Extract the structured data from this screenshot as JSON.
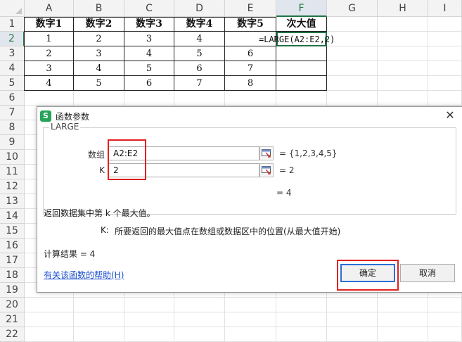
{
  "columns": [
    "A",
    "B",
    "C",
    "D",
    "E",
    "F",
    "G",
    "H",
    "I"
  ],
  "selected_column": "F",
  "rows": [
    "1",
    "2",
    "3",
    "4",
    "5",
    "6",
    "7",
    "8",
    "9",
    "10",
    "11",
    "12",
    "13",
    "14",
    "15",
    "16",
    "17",
    "18",
    "19",
    "20",
    "21",
    "22"
  ],
  "selected_row": "2",
  "table": {
    "headers": [
      "数字1",
      "数字2",
      "数字3",
      "数字4",
      "数字5",
      "次大值"
    ],
    "data": [
      [
        "1",
        "2",
        "3",
        "4",
        "",
        ""
      ],
      [
        "2",
        "3",
        "4",
        "5",
        "6",
        ""
      ],
      [
        "3",
        "4",
        "5",
        "6",
        "7",
        ""
      ],
      [
        "4",
        "5",
        "6",
        "7",
        "8",
        ""
      ]
    ]
  },
  "formula_text": "=LARGE(A2:E2,2)",
  "dialog": {
    "title": "函数参数",
    "app_icon": "S",
    "close_glyph": "✕",
    "function_name": "LARGE",
    "args": [
      {
        "label": "数组",
        "value": "A2:E2",
        "result": "= {1,2,3,4,5}"
      },
      {
        "label": "K",
        "value": "2",
        "result": "= 2"
      }
    ],
    "overall_result": "= 4",
    "description": "返回数据集中第 k 个最大值。",
    "param_help_label": "K:",
    "param_help_text": "所要返回的最大值点在数组或数据区中的位置(从最大值开始)",
    "calc_result": "计算结果 = 4",
    "help_link": "有关该函数的帮助(H)",
    "ok_label": "确定",
    "cancel_label": "取消"
  },
  "colors": {
    "accent_green": "#217346",
    "highlight_red": "#e02020",
    "link_blue": "#1a4fd0",
    "wps_icon_green": "#27a35a"
  }
}
